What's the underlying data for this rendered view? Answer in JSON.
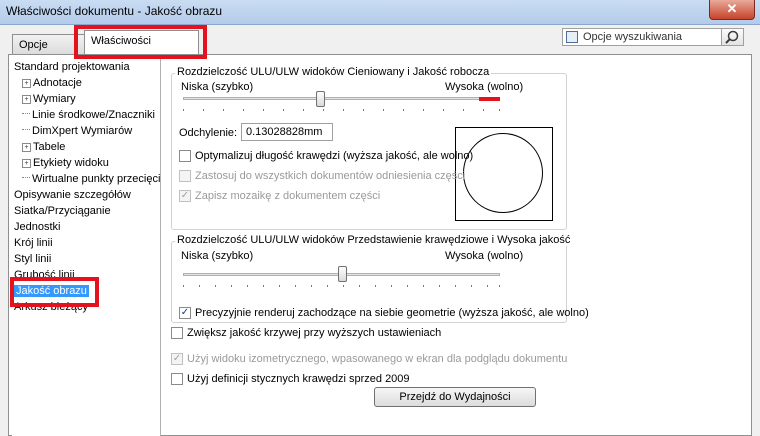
{
  "window": {
    "title": "Właściwości dokumentu - Jakość obrazu",
    "close_glyph": "✕"
  },
  "tabs": [
    {
      "label": "Opcje systemu",
      "active": false
    },
    {
      "label": "Właściwości dokumentu",
      "active": true
    }
  ],
  "search": {
    "placeholder": "Opcje wyszukiwania",
    "icon": "magnifier-icon"
  },
  "tree": {
    "items": [
      {
        "label": "Standard projektowania",
        "level": 0,
        "expander": ""
      },
      {
        "label": "Adnotacje",
        "level": 1,
        "expander": "+"
      },
      {
        "label": "Wymiary",
        "level": 1,
        "expander": "+"
      },
      {
        "label": "Linie środkowe/Znaczniki",
        "level": 1,
        "expander": ""
      },
      {
        "label": "DimXpert Wymiarów",
        "level": 1,
        "expander": ""
      },
      {
        "label": "Tabele",
        "level": 1,
        "expander": "+"
      },
      {
        "label": "Etykiety widoku",
        "level": 1,
        "expander": "+"
      },
      {
        "label": "Wirtualne punkty przecięcia",
        "level": 1,
        "expander": ""
      },
      {
        "label": "Opisywanie szczegółów",
        "level": 0,
        "expander": ""
      },
      {
        "label": "Siatka/Przyciąganie",
        "level": 0,
        "expander": ""
      },
      {
        "label": "Jednostki",
        "level": 0,
        "expander": ""
      },
      {
        "label": "Krój linii",
        "level": 0,
        "expander": ""
      },
      {
        "label": "Styl linii",
        "level": 0,
        "expander": ""
      },
      {
        "label": "Grubość linii",
        "level": 0,
        "expander": ""
      },
      {
        "label": "Jakość obrazu",
        "level": 0,
        "expander": "",
        "selected": true
      },
      {
        "label": "Arkusz bieżący",
        "level": 0,
        "expander": ""
      }
    ]
  },
  "group1": {
    "title": "Rozdzielczość ULU/ULW widoków Cieniowany i Jakość robocza",
    "low_label": "Niska (szybko)",
    "high_label": "Wysoka (wolno)",
    "slider_level": 0.5,
    "deviation_label": "Odchylenie:",
    "deviation_value": "0.13028828mm",
    "optimize_label": "Optymalizuj długość krawędzi (wyższa jakość, ale wolno)",
    "optimize_checked": false,
    "apply_all_label": "Zastosuj do wszystkich dokumentów odniesienia części",
    "apply_all_checked": false,
    "save_mosaic_label": "Zapisz mozaikę z dokumentem części",
    "save_mosaic_checked": true
  },
  "group2": {
    "title": "Rozdzielczość ULU/ULW widoków Przedstawienie krawędziowe i Wysoka jakość",
    "low_label": "Niska (szybko)",
    "high_label": "Wysoka (wolno)",
    "slider_level": 0.5,
    "precise_label": "Precyzyjnie renderuj zachodzące na siebie geometrie (wyższa jakość, ale wolno)",
    "precise_checked": true
  },
  "curve_quality_label": "Zwiększ jakość krzywej przy wyższych ustawieniach",
  "curve_quality_checked": false,
  "isometric_label": "Użyj widoku izometrycznego, wpasowanego w ekran dla podglądu dokumentu",
  "isometric_checked": true,
  "tangent_label": "Użyj definicji stycznych krawędzi sprzed 2009",
  "tangent_checked": false,
  "performance_button": "Przejdź do Wydajności",
  "check_glyph": "✓",
  "highlight_color": "#e3121e",
  "selection_color": "#3399ff"
}
